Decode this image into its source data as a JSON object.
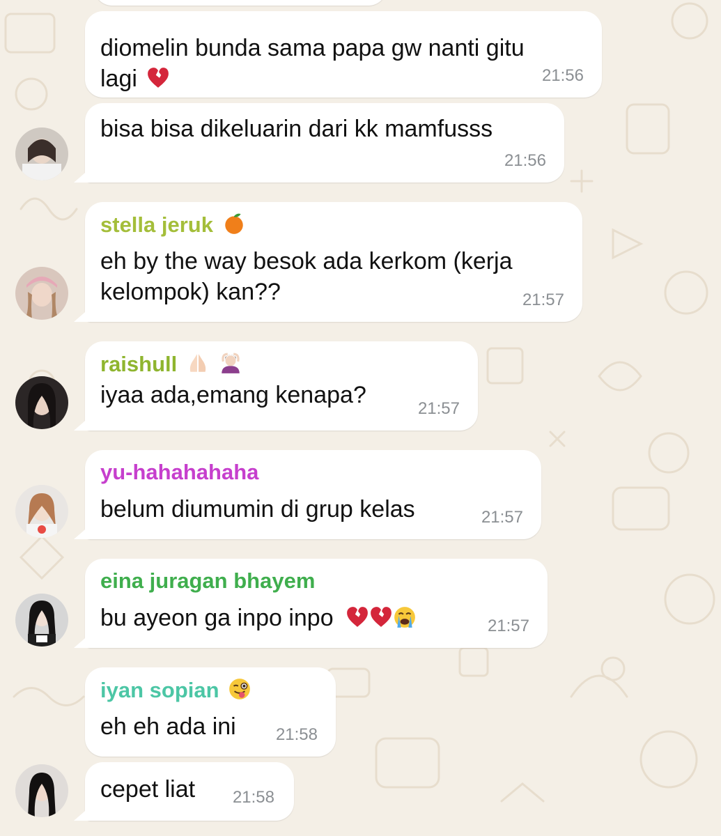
{
  "chat": {
    "top_bubble": {
      "lines": [
        "diomelin bunda sama papa gw nanti gitu",
        "lagi"
      ],
      "time": "21:56",
      "trailing_icon": "broken-heart-icon"
    },
    "messages": [
      {
        "sender": null,
        "text": "bisa bisa dikeluarin dari kk mamfusss",
        "time": "21:56",
        "avatar": "avatar-1"
      },
      {
        "sender": "stella jeruk",
        "sender_color": "#a4be3a",
        "sender_icon": "tangerine-icon",
        "lines": [
          "eh by the way besok ada kerkom (kerja",
          "kelompok) kan??"
        ],
        "time": "21:57",
        "avatar": "avatar-2"
      },
      {
        "sender": "raishull",
        "sender_color": "#8fb52f",
        "sender_icon": [
          "folded-hands-icon",
          "person-gesturing-ok-icon"
        ],
        "text": "iyaa ada,emang kenapa?",
        "time": "21:57",
        "avatar": "avatar-3"
      },
      {
        "sender": "yu-hahahahaha",
        "sender_color": "#c63fcd",
        "text": "belum diumumin di grup kelas",
        "time": "21:57",
        "avatar": "avatar-4"
      },
      {
        "sender": "eina juragan bhayem",
        "sender_color": "#3fae4d",
        "text": "bu ayeon ga inpo inpo",
        "text_icons": [
          "broken-heart-icon",
          "broken-heart-icon",
          "crying-face-icon"
        ],
        "time": "21:57",
        "avatar": "avatar-5"
      },
      {
        "sender": "iyan sopian",
        "sender_color": "#4cc6a5",
        "sender_icon": "winking-face-tongue-icon",
        "text": "eh eh ada ini",
        "time": "21:58",
        "avatar": null
      },
      {
        "sender": null,
        "text": "cepet liat",
        "time": "21:58",
        "avatar": "avatar-6"
      }
    ]
  },
  "colors": {
    "background": "#f4efe6",
    "bubble": "#ffffff",
    "timestamp": "#8b8f93"
  }
}
